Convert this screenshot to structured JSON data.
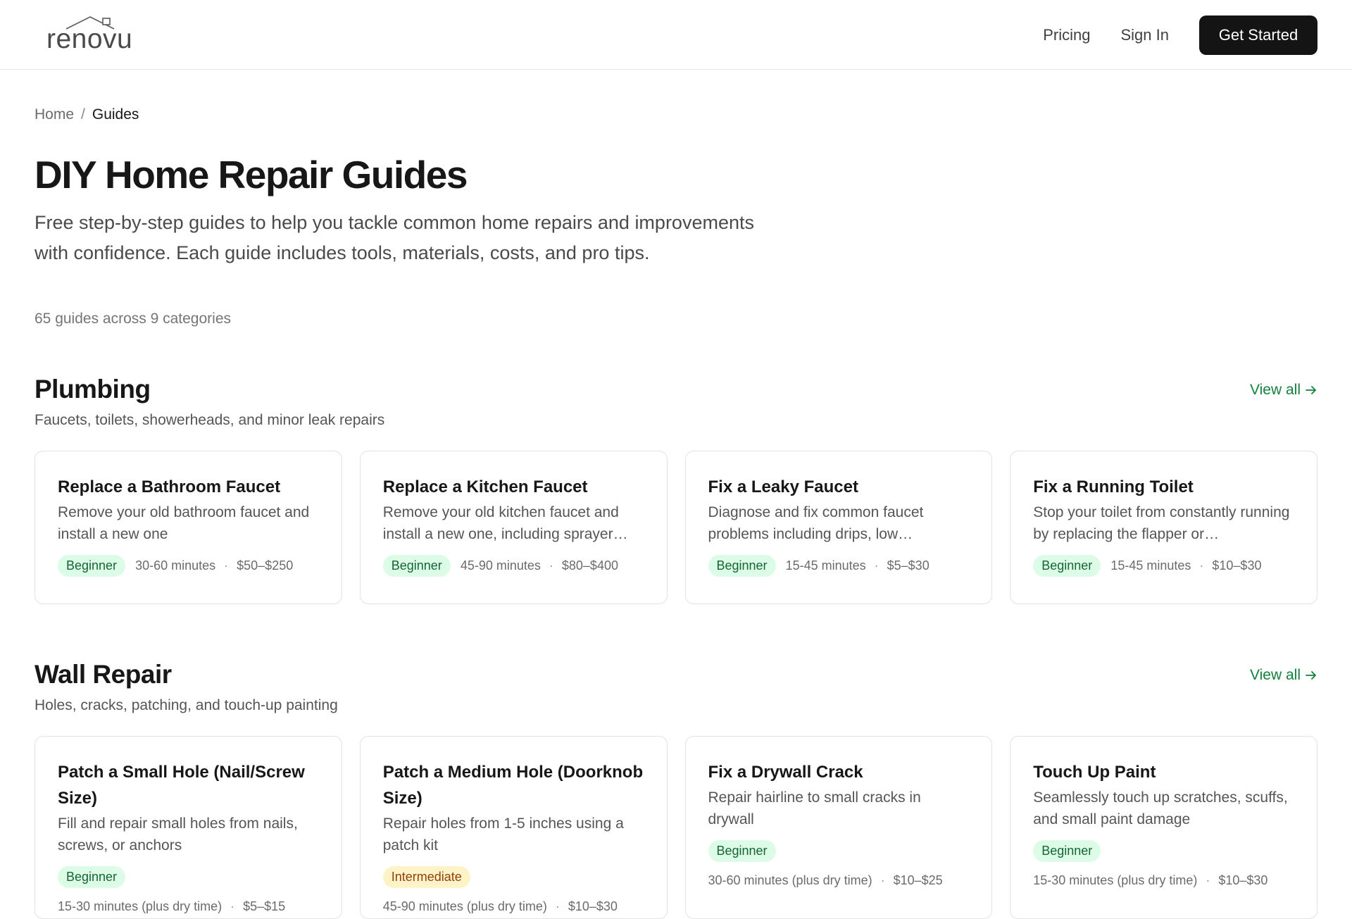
{
  "header": {
    "logo_text": "renovu",
    "nav": {
      "pricing": "Pricing",
      "sign_in": "Sign In",
      "get_started": "Get Started"
    }
  },
  "breadcrumb": {
    "home": "Home",
    "separator": "/",
    "current": "Guides"
  },
  "page": {
    "title": "DIY Home Repair Guides",
    "intro": "Free step-by-step guides to help you tackle common home repairs and improvements with confidence. Each guide includes tools, materials, costs, and pro tips.",
    "meta": "65 guides across 9 categories"
  },
  "sections": [
    {
      "title": "Plumbing",
      "subtitle": "Faucets, toilets, showerheads, and minor leak repairs",
      "view_all": "View all",
      "cards": [
        {
          "title": "Replace a Bathroom Faucet",
          "desc": "Remove your old bathroom faucet and install a new one",
          "level": "Beginner",
          "time": "30-60 minutes",
          "cost": "$50–$250"
        },
        {
          "title": "Replace a Kitchen Faucet",
          "desc": "Remove your old kitchen faucet and install a new one, including sprayer…",
          "level": "Beginner",
          "time": "45-90 minutes",
          "cost": "$80–$400"
        },
        {
          "title": "Fix a Leaky Faucet",
          "desc": "Diagnose and fix common faucet problems including drips, low…",
          "level": "Beginner",
          "time": "15-45 minutes",
          "cost": "$5–$30"
        },
        {
          "title": "Fix a Running Toilet",
          "desc": "Stop your toilet from constantly running by replacing the flapper or…",
          "level": "Beginner",
          "time": "15-45 minutes",
          "cost": "$10–$30"
        }
      ]
    },
    {
      "title": "Wall Repair",
      "subtitle": "Holes, cracks, patching, and touch-up painting",
      "view_all": "View all",
      "cards": [
        {
          "title": "Patch a Small Hole (Nail/Screw Size)",
          "desc": "Fill and repair small holes from nails, screws, or anchors",
          "level": "Beginner",
          "time": "15-30 minutes (plus dry time)",
          "cost": "$5–$15"
        },
        {
          "title": "Patch a Medium Hole (Doorknob Size)",
          "desc": "Repair holes from 1-5 inches using a patch kit",
          "level": "Intermediate",
          "time": "45-90 minutes (plus dry time)",
          "cost": "$10–$30"
        },
        {
          "title": "Fix a Drywall Crack",
          "desc": "Repair hairline to small cracks in drywall",
          "level": "Beginner",
          "time": "30-60 minutes (plus dry time)",
          "cost": "$10–$25"
        },
        {
          "title": "Touch Up Paint",
          "desc": "Seamlessly touch up scratches, scuffs, and small paint damage",
          "level": "Beginner",
          "time": "15-30 minutes (plus dry time)",
          "cost": "$10–$30"
        }
      ]
    }
  ],
  "colors": {
    "accent_green": "#13803d",
    "badge_beginner_bg": "#dcfce7",
    "badge_intermediate_bg": "#fef3c7",
    "cta_bg": "#141414"
  },
  "icons": {
    "logo_roof": "house-roof-icon",
    "view_all_arrow": "arrow-right-icon"
  }
}
